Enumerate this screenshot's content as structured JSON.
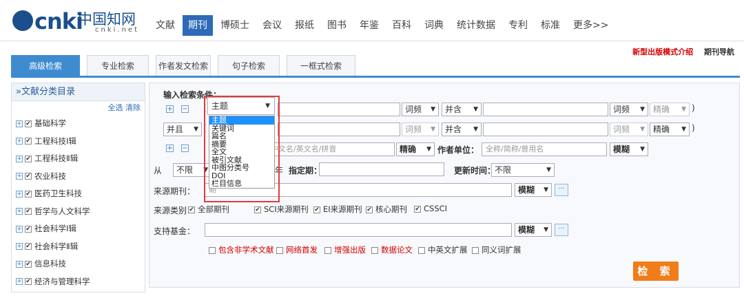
{
  "brand": {
    "logo_text": "cnki",
    "logo_zh": "中国知网",
    "logo_net": "cnki.net"
  },
  "nav": [
    "文献",
    "期刊",
    "博硕士",
    "会议",
    "报纸",
    "图书",
    "年鉴",
    "百科",
    "词典",
    "统计数据",
    "专利",
    "标准",
    "更多>>"
  ],
  "nav_active": "期刊",
  "toplinks": {
    "new_style": "新型出版模式介绍",
    "journal_nav": "期刊导航"
  },
  "tabs": [
    "高级检索",
    "专业检索",
    "作者发文检索",
    "句子检索",
    "一框式检索"
  ],
  "sidebar": {
    "title": "»文献分类目录",
    "select_all": "全选",
    "clear": "清除",
    "items": [
      "基础科学",
      "工程科技Ⅰ辑",
      "工程科技Ⅱ辑",
      "农业科技",
      "医药卫生科技",
      "哲学与人文科学",
      "社会科学Ⅰ辑",
      "社会科学Ⅱ辑",
      "信息科技",
      "经济与管理科学"
    ]
  },
  "form": {
    "heading": "输入检索条件：",
    "row1": {
      "field": "主题",
      "freq": "词频",
      "logic": "并含",
      "freq2": "词频",
      "match": "精确",
      "paren_close": ")"
    },
    "row2": {
      "bool": "并且",
      "paren_open": "(",
      "freq": "词频",
      "logic": "并含",
      "freq2": "词频",
      "match": "精确",
      "paren_close": ")"
    },
    "row3": {
      "author_placeholder": "中文名/英文名/拼音",
      "match": "精确",
      "unit_label": "作者单位：",
      "unit_placeholder": "全称/简称/曾用名",
      "unit_match": "模糊"
    },
    "row4": {
      "from": "从",
      "from_val": "不限",
      "year": "年",
      "specified": "指定期：",
      "update": "更新时间：",
      "update_val": "不限"
    },
    "source_label": "来源期刊：",
    "source_hint": "期",
    "source_match": "模糊",
    "category_label": "来源类别：",
    "categories": [
      "全部期刊",
      "SCI来源期刊",
      "EI来源期刊",
      "核心期刊",
      "CSSCI"
    ],
    "fund_label": "支持基金：",
    "fund_match": "模糊",
    "extras": [
      "包含非学术文献",
      "网络首发",
      "增强出版",
      "数据论文",
      "中英文扩展",
      "同义词扩展"
    ],
    "search_button": "检 索"
  },
  "dropdown": {
    "selected": "主题",
    "options": [
      "主题",
      "关键词",
      "篇名",
      "摘要",
      "全文",
      "被引文献",
      "中图分类号",
      "DOI",
      "栏目信息"
    ],
    "highlighted": 0
  },
  "colors": {
    "accent": "#3e8bd0",
    "nav_active": "#2e6ab8",
    "search": "#f07d1a",
    "red": "#d40000",
    "highlight_box": "#e23a3a"
  }
}
